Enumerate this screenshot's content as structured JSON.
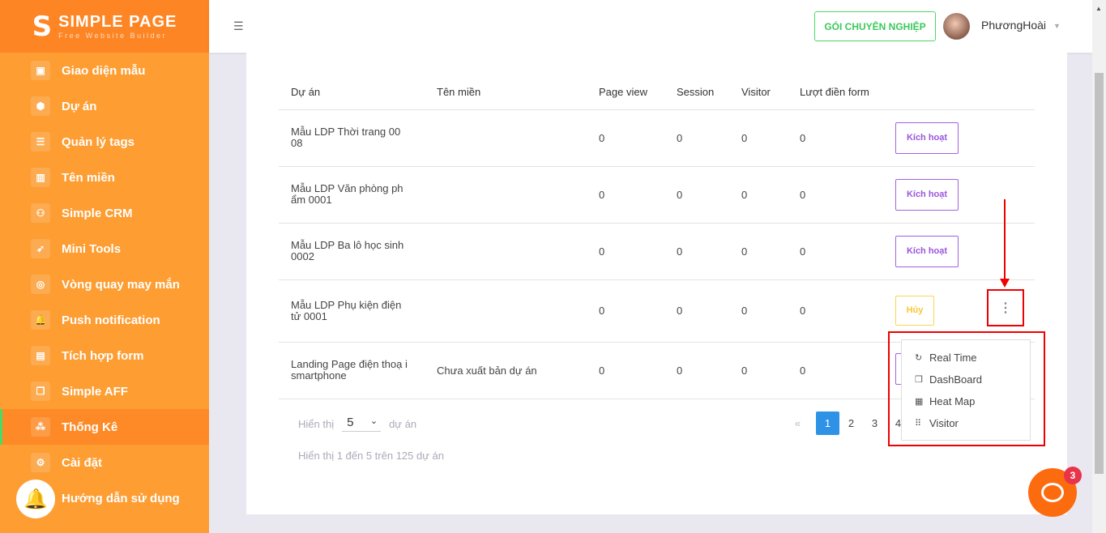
{
  "brand": {
    "logo_letter": "S",
    "name": "SIMPLE PAGE",
    "tagline": "Free Website Builder"
  },
  "sidebar": {
    "items": [
      {
        "label": "Giao diện mẫu",
        "icon": "template-icon"
      },
      {
        "label": "Dự án",
        "icon": "cube-icon"
      },
      {
        "label": "Quản lý tags",
        "icon": "list-icon"
      },
      {
        "label": "Tên miền",
        "icon": "bar-chart-icon"
      },
      {
        "label": "Simple CRM",
        "icon": "users-icon"
      },
      {
        "label": "Mini Tools",
        "icon": "rocket-icon"
      },
      {
        "label": "Vòng quay may mắn",
        "icon": "wheel-icon"
      },
      {
        "label": "Push notification",
        "icon": "bell-icon"
      },
      {
        "label": "Tích hợp form",
        "icon": "form-icon"
      },
      {
        "label": "Simple AFF",
        "icon": "copy-icon"
      },
      {
        "label": "Thống Kê",
        "icon": "stats-icon",
        "active": true
      },
      {
        "label": "Cài đặt",
        "icon": "gear-icon"
      },
      {
        "label": "Hướng dẫn sử dụng",
        "icon": "book-icon"
      }
    ]
  },
  "header": {
    "pro_button": "GÓI CHUYÊN NGHIỆP",
    "user_name": "PhươngHoài"
  },
  "table": {
    "columns": [
      "Dự án",
      "Tên miền",
      "Page view",
      "Session",
      "Visitor",
      "Lượt điền form"
    ],
    "rows": [
      {
        "project": "Mẫu LDP Thời trang 00 08",
        "domain": "",
        "pageview": "0",
        "session": "0",
        "visitor": "0",
        "form": "0",
        "action": "Kích hoạt"
      },
      {
        "project": "Mẫu LDP Văn phòng ph ẩm 0001",
        "domain": "",
        "pageview": "0",
        "session": "0",
        "visitor": "0",
        "form": "0",
        "action": "Kích hoạt"
      },
      {
        "project": "Mẫu LDP Ba lô học sinh 0002",
        "domain": "",
        "pageview": "0",
        "session": "0",
        "visitor": "0",
        "form": "0",
        "action": "Kích hoạt"
      },
      {
        "project": "Mẫu LDP Phụ kiện điện tử 0001",
        "domain": "",
        "pageview": "0",
        "session": "0",
        "visitor": "0",
        "form": "0",
        "action": "Hủy"
      },
      {
        "project": "Landing Page điện thoạ i smartphone",
        "domain": "Chưa xuất bản dự án",
        "pageview": "0",
        "session": "0",
        "visitor": "0",
        "form": "0",
        "action": ""
      }
    ]
  },
  "dropdown": {
    "items": [
      {
        "label": "Real Time",
        "icon": "refresh-icon"
      },
      {
        "label": "DashBoard",
        "icon": "dashboard-icon"
      },
      {
        "label": "Heat Map",
        "icon": "heatmap-icon"
      },
      {
        "label": "Visitor",
        "icon": "dots-grid-icon"
      }
    ]
  },
  "footer": {
    "show_label": "Hiển thị",
    "page_size": "5",
    "unit": "dự án",
    "summary": "Hiển thị 1 đến 5 trên 125 dự án"
  },
  "pagination": {
    "prev": "«",
    "pages": [
      "1",
      "2",
      "3",
      "4"
    ],
    "current": "1"
  },
  "chat": {
    "badge": "3"
  },
  "colors": {
    "sidebar": "#fd9d32",
    "accent_green": "#4cd964",
    "purple": "#9b55dc",
    "annotation_red": "#ee0000"
  }
}
